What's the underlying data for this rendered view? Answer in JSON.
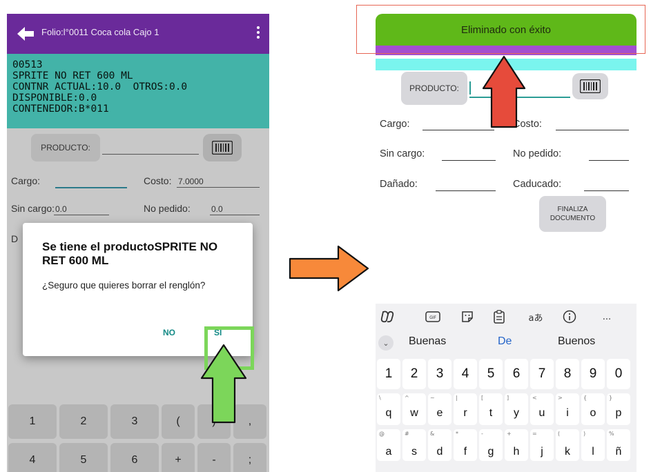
{
  "left_screen": {
    "appbar": {
      "title": "Folio:l°0011 Coca cola Cajo 1"
    },
    "info": [
      "00513",
      "SPRITE NO RET 600 ML",
      "CONTNR ACTUAL:10.0  OTROS:0.0",
      "DISPONIBLE:0.0",
      "CONTENEDOR:B*011"
    ],
    "form": {
      "producto_label": "PRODUCTO:",
      "cargo_label": "Cargo:",
      "costo_label": "Costo:",
      "costo_value": "7.0000",
      "sin_cargo_label": "Sin cargo:",
      "sin_cargo_value": "0.0",
      "no_pedido_label": "No pedido:",
      "no_pedido_value": "0.0",
      "hidden_label_fragment": "D"
    },
    "dialog": {
      "title": "Se tiene el productoSPRITE NO RET 600 ML",
      "message": "¿Seguro que quieres borrar el renglón?",
      "no_label": "NO",
      "si_label": "SI"
    },
    "keypad": {
      "row1": [
        "1",
        "2",
        "3",
        "(",
        ")",
        ","
      ],
      "row2": [
        "4",
        "5",
        "6",
        "+",
        "-",
        ";"
      ]
    }
  },
  "right_screen": {
    "toast": "Eliminado con éxito",
    "form": {
      "producto_label": "PRODUCTO:",
      "cargo_label": "Cargo:",
      "costo_label": "Costo:",
      "sin_cargo_label": "Sin cargo:",
      "no_pedido_label": "No pedido:",
      "danado_label": "Dañado:",
      "caducado_label": "Caducado:",
      "finaliza_line1": "FINALIZA",
      "finaliza_line2": "DOCUMENTO"
    },
    "keyboard": {
      "toolbar": [
        "copilot-icon",
        "gif-icon",
        "sticker-icon",
        "clipboard-icon",
        "aあ",
        "info-icon",
        "..."
      ],
      "suggestions": [
        "Buenas",
        "De",
        "Buenos"
      ],
      "numbers": [
        "1",
        "2",
        "3",
        "4",
        "5",
        "6",
        "7",
        "8",
        "9",
        "0"
      ],
      "row_qwerty": [
        {
          "k": "q",
          "h": "\\"
        },
        {
          "k": "w",
          "h": "^"
        },
        {
          "k": "e",
          "h": "~"
        },
        {
          "k": "r",
          "h": "|"
        },
        {
          "k": "t",
          "h": "["
        },
        {
          "k": "y",
          "h": "]"
        },
        {
          "k": "u",
          "h": "<"
        },
        {
          "k": "i",
          "h": ">"
        },
        {
          "k": "o",
          "h": "{"
        },
        {
          "k": "p",
          "h": "}"
        }
      ],
      "row_asdf": [
        {
          "k": "a",
          "h": "@"
        },
        {
          "k": "s",
          "h": "#"
        },
        {
          "k": "d",
          "h": "&"
        },
        {
          "k": "f",
          "h": "*"
        },
        {
          "k": "g",
          "h": "-"
        },
        {
          "k": "h",
          "h": "+"
        },
        {
          "k": "j",
          "h": "="
        },
        {
          "k": "k",
          "h": "("
        },
        {
          "k": "l",
          "h": ")"
        },
        {
          "k": "ñ",
          "h": "%"
        }
      ]
    }
  },
  "colors": {
    "appbar_purple": "#6a2a9a",
    "info_teal": "#43b3a8",
    "toast_green": "#5fb819",
    "accent_teal": "#128a86",
    "highlight_green": "#7cd65a",
    "arrow_orange": "#f7893a",
    "arrow_red": "#e64b3b",
    "annotation_red": "#e76553"
  }
}
